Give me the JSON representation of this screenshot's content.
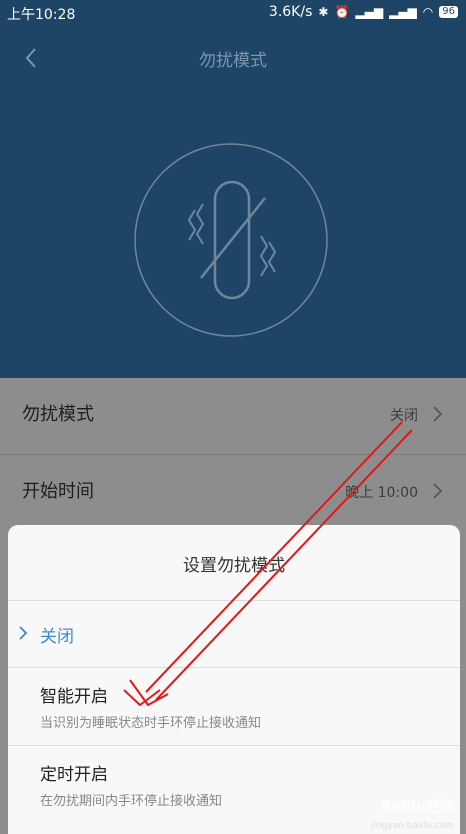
{
  "status": {
    "time": "上午10:28",
    "speed": "3.6K/s",
    "battery": "96",
    "icons": [
      "bluetooth-icon",
      "alarm-icon",
      "signal-icon",
      "signal-icon",
      "wifi-icon"
    ]
  },
  "header": {
    "title": "勿扰模式",
    "back_icon": "chevron-left-icon",
    "hero_icon": "vibration-off-icon",
    "color": "#1f4566"
  },
  "settings": [
    {
      "label": "勿扰模式",
      "value": "关闭"
    },
    {
      "label": "开始时间",
      "value": "晚上 10:00"
    }
  ],
  "sheet": {
    "title": "设置勿扰模式",
    "selected": "关闭",
    "accent": "#3a8ad6",
    "options": [
      {
        "label": "智能开启",
        "desc": "当识别为睡眠状态时手环停止接收通知"
      },
      {
        "label": "定时开启",
        "desc": "在勿扰期间内手环停止接收通知"
      }
    ]
  },
  "annotation": {
    "arrow_color": "#e01818"
  },
  "watermark": {
    "text": "Baidu经验",
    "sub": "jingyan.baidu.com"
  }
}
